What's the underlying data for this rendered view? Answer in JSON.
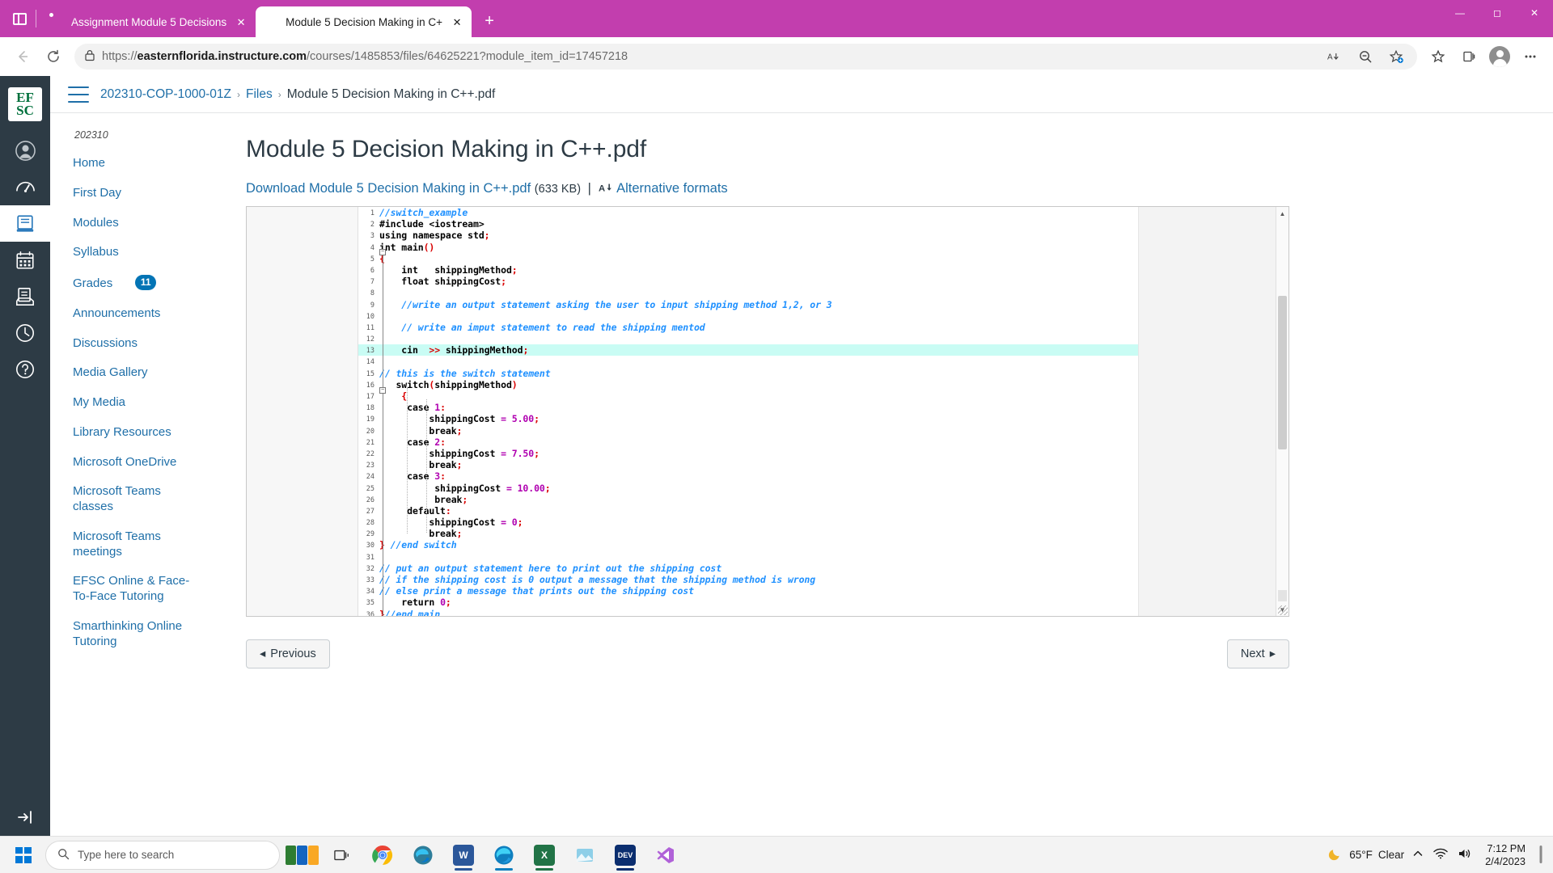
{
  "browser": {
    "tabs": [
      {
        "title": "Assignment Module 5 Decisions",
        "favicon": "canvas-icon",
        "active": false
      },
      {
        "title": "Module 5 Decision Making in C+",
        "favicon": "canvas-icon",
        "active": true
      }
    ],
    "new_tab_label": "+",
    "window_controls": {
      "minimize": "—",
      "maximize": "☐",
      "close": "✕"
    },
    "toolbar": {
      "back_icon": "back-arrow-icon",
      "refresh_icon": "refresh-icon",
      "lock_icon": "lock-icon",
      "url_scheme": "https://",
      "url_host": "easternflorida.instructure.com",
      "url_path": "/courses/1485853/files/64625221?module_item_id=17457218",
      "read_aloud_icon": "read-aloud-icon",
      "zoom_out_icon": "zoom-out-icon",
      "favorites_add_icon": "add-favorite-icon",
      "favorites_icon": "favorites-icon",
      "collections_icon": "collections-icon",
      "profile_icon": "profile-icon",
      "settings_icon": "more-settings-icon"
    }
  },
  "globalnav": {
    "logo_line1": "EF",
    "logo_line2": "SC",
    "items": [
      {
        "name": "account",
        "label": "Account"
      },
      {
        "name": "dashboard",
        "label": "Dashboard"
      },
      {
        "name": "courses",
        "label": "Courses",
        "active": true
      },
      {
        "name": "calendar",
        "label": "Calendar"
      },
      {
        "name": "inbox",
        "label": "Inbox"
      },
      {
        "name": "history",
        "label": "History"
      },
      {
        "name": "help",
        "label": "Help"
      }
    ]
  },
  "coursenav": {
    "term": "202310",
    "items": [
      {
        "label": "Home",
        "badge": null
      },
      {
        "label": "First Day",
        "badge": null
      },
      {
        "label": "Modules",
        "badge": null
      },
      {
        "label": "Syllabus",
        "badge": null
      },
      {
        "label": "Grades",
        "badge": "11"
      },
      {
        "label": "Announcements",
        "badge": null
      },
      {
        "label": "Discussions",
        "badge": null
      },
      {
        "label": "Media Gallery",
        "badge": null
      },
      {
        "label": "My Media",
        "badge": null
      },
      {
        "label": "Library Resources",
        "badge": null
      },
      {
        "label": "Microsoft OneDrive",
        "badge": null
      },
      {
        "label": "Microsoft Teams classes",
        "badge": null
      },
      {
        "label": "Microsoft Teams meetings",
        "badge": null
      },
      {
        "label": "EFSC Online & Face-To-Face Tutoring",
        "badge": null
      },
      {
        "label": "Smarthinking Online Tutoring",
        "badge": null
      }
    ]
  },
  "breadcrumb": {
    "course": "202310-COP-1000-01Z",
    "section": "Files",
    "current": "Module 5 Decision Making in C++.pdf"
  },
  "main": {
    "file_title": "Module 5 Decision Making in C++.pdf",
    "download_label": "Download Module 5 Decision Making in C++.pdf",
    "file_size": "(633 KB)",
    "separator": "|",
    "alt_formats_label": "Alternative formats",
    "alt_formats_icon": "accessibility-download-icon"
  },
  "pager": {
    "previous_label": "Previous",
    "previous_arrow": "◂",
    "next_label": "Next",
    "next_arrow": "▸"
  },
  "pdf": {
    "lines": [
      {
        "n": "1",
        "tokens": [
          {
            "t": "//switch_example",
            "c": "cm"
          }
        ],
        "indent": 0
      },
      {
        "n": "2",
        "tokens": [
          {
            "t": "#include <iostream>",
            "c": "pp"
          }
        ],
        "indent": 0
      },
      {
        "n": "3",
        "tokens": [
          {
            "t": "using namespace std",
            "c": "kw"
          },
          {
            "t": ";",
            "c": "pn"
          }
        ],
        "indent": 0
      },
      {
        "n": "4",
        "tokens": [
          {
            "t": "int main",
            "c": "kw"
          },
          {
            "t": "()",
            "c": "pn"
          }
        ],
        "indent": 0
      },
      {
        "n": "5",
        "tokens": [
          {
            "t": "{",
            "c": "pn"
          }
        ],
        "indent": 0
      },
      {
        "n": "6",
        "tokens": [
          {
            "t": "    int   shippingMethod",
            "c": "kw"
          },
          {
            "t": ";",
            "c": "pn"
          }
        ],
        "indent": 0
      },
      {
        "n": "7",
        "tokens": [
          {
            "t": "    float shippingCost",
            "c": "kw"
          },
          {
            "t": ";",
            "c": "pn"
          }
        ],
        "indent": 0
      },
      {
        "n": "8",
        "tokens": [],
        "indent": 0
      },
      {
        "n": "9",
        "tokens": [
          {
            "t": "    //write an output statement asking the user to input shipping method 1,2, or 3",
            "c": "cm"
          }
        ],
        "indent": 0
      },
      {
        "n": "10",
        "tokens": [],
        "indent": 0
      },
      {
        "n": "11",
        "tokens": [
          {
            "t": "    // write an imput statement to read the shipping mentod",
            "c": "cm"
          }
        ],
        "indent": 0
      },
      {
        "n": "12",
        "tokens": [],
        "indent": 0
      },
      {
        "n": "13",
        "tokens": [
          {
            "t": "    cin  ",
            "c": "kw"
          },
          {
            "t": ">>",
            "c": "op"
          },
          {
            "t": " shippingMethod",
            "c": "kw"
          },
          {
            "t": ";",
            "c": "pn"
          }
        ],
        "indent": 0,
        "highlight": true
      },
      {
        "n": "14",
        "tokens": [],
        "indent": 0
      },
      {
        "n": "15",
        "tokens": [
          {
            "t": "// this is the switch statement",
            "c": "cm"
          }
        ],
        "indent": 0
      },
      {
        "n": "16",
        "tokens": [
          {
            "t": "   switch",
            "c": "kw"
          },
          {
            "t": "(",
            "c": "pn"
          },
          {
            "t": "shippingMethod",
            "c": "kw"
          },
          {
            "t": ")",
            "c": "pn"
          }
        ],
        "indent": 0
      },
      {
        "n": "17",
        "tokens": [
          {
            "t": "    ",
            "c": "kw"
          },
          {
            "t": "{",
            "c": "pn"
          }
        ],
        "indent": 0
      },
      {
        "n": "18",
        "tokens": [
          {
            "t": "     case ",
            "c": "kw"
          },
          {
            "t": "1",
            "c": "num"
          },
          {
            "t": ":",
            "c": "pn"
          }
        ],
        "indent": 0
      },
      {
        "n": "19",
        "tokens": [
          {
            "t": "         shippingCost ",
            "c": "kw"
          },
          {
            "t": "=",
            "c": "num"
          },
          {
            "t": " ",
            "c": "kw"
          },
          {
            "t": "5.00",
            "c": "num"
          },
          {
            "t": ";",
            "c": "pn"
          }
        ],
        "indent": 0
      },
      {
        "n": "20",
        "tokens": [
          {
            "t": "         break",
            "c": "kw"
          },
          {
            "t": ";",
            "c": "pn"
          }
        ],
        "indent": 0
      },
      {
        "n": "21",
        "tokens": [
          {
            "t": "     case ",
            "c": "kw"
          },
          {
            "t": "2",
            "c": "num"
          },
          {
            "t": ":",
            "c": "pn"
          }
        ],
        "indent": 0
      },
      {
        "n": "22",
        "tokens": [
          {
            "t": "         shippingCost ",
            "c": "kw"
          },
          {
            "t": "=",
            "c": "num"
          },
          {
            "t": " ",
            "c": "kw"
          },
          {
            "t": "7.50",
            "c": "num"
          },
          {
            "t": ";",
            "c": "pn"
          }
        ],
        "indent": 0
      },
      {
        "n": "23",
        "tokens": [
          {
            "t": "         break",
            "c": "kw"
          },
          {
            "t": ";",
            "c": "pn"
          }
        ],
        "indent": 0
      },
      {
        "n": "24",
        "tokens": [
          {
            "t": "     case ",
            "c": "kw"
          },
          {
            "t": "3",
            "c": "num"
          },
          {
            "t": ":",
            "c": "pn"
          }
        ],
        "indent": 0
      },
      {
        "n": "25",
        "tokens": [
          {
            "t": "          shippingCost ",
            "c": "kw"
          },
          {
            "t": "=",
            "c": "num"
          },
          {
            "t": " ",
            "c": "kw"
          },
          {
            "t": "10.00",
            "c": "num"
          },
          {
            "t": ";",
            "c": "pn"
          }
        ],
        "indent": 0
      },
      {
        "n": "26",
        "tokens": [
          {
            "t": "          break",
            "c": "kw"
          },
          {
            "t": ";",
            "c": "pn"
          }
        ],
        "indent": 0
      },
      {
        "n": "27",
        "tokens": [
          {
            "t": "     default",
            "c": "kw"
          },
          {
            "t": ":",
            "c": "pn"
          }
        ],
        "indent": 0
      },
      {
        "n": "28",
        "tokens": [
          {
            "t": "         shippingCost ",
            "c": "kw"
          },
          {
            "t": "=",
            "c": "num"
          },
          {
            "t": " ",
            "c": "kw"
          },
          {
            "t": "0",
            "c": "num"
          },
          {
            "t": ";",
            "c": "pn"
          }
        ],
        "indent": 0
      },
      {
        "n": "29",
        "tokens": [
          {
            "t": "         break",
            "c": "kw"
          },
          {
            "t": ";",
            "c": "pn"
          }
        ],
        "indent": 0
      },
      {
        "n": "30",
        "tokens": [
          {
            "t": "}",
            "c": "pn"
          },
          {
            "t": " //end switch",
            "c": "cm"
          }
        ],
        "indent": 0
      },
      {
        "n": "31",
        "tokens": [],
        "indent": 0
      },
      {
        "n": "32",
        "tokens": [
          {
            "t": "// put an output statement here to print out the shipping cost",
            "c": "cm"
          }
        ],
        "indent": 0
      },
      {
        "n": "33",
        "tokens": [
          {
            "t": "// if the shipping cost is 0 output a message that the shipping method is wrong",
            "c": "cm"
          }
        ],
        "indent": 0
      },
      {
        "n": "34",
        "tokens": [
          {
            "t": "// else print a message that prints out the shipping cost",
            "c": "cm"
          }
        ],
        "indent": 0
      },
      {
        "n": "35",
        "tokens": [
          {
            "t": "    return ",
            "c": "kw"
          },
          {
            "t": "0",
            "c": "num"
          },
          {
            "t": ";",
            "c": "pn"
          }
        ],
        "indent": 0
      },
      {
        "n": "36",
        "tokens": [
          {
            "t": "}",
            "c": "pn"
          },
          {
            "t": "//end main",
            "c": "cm"
          }
        ],
        "indent": 0
      }
    ]
  },
  "taskbar": {
    "start_icon": "windows-start-icon",
    "search_placeholder": "Type here to search",
    "search_icon": "search-icon",
    "task_view_icon": "task-view-icon",
    "apps": [
      {
        "name": "widgets-news",
        "label": ""
      },
      {
        "name": "task-view",
        "label": ""
      },
      {
        "name": "google-chrome",
        "label": ""
      },
      {
        "name": "edge-dev",
        "label": ""
      },
      {
        "name": "microsoft-word",
        "label": "W"
      },
      {
        "name": "microsoft-edge",
        "label": ""
      },
      {
        "name": "microsoft-excel",
        "label": "X"
      },
      {
        "name": "photos",
        "label": ""
      },
      {
        "name": "dev-cpp",
        "label": "DEV"
      },
      {
        "name": "visual-studio",
        "label": ""
      }
    ],
    "weather_icon": "moon-icon",
    "temperature": "65°F",
    "condition": "Clear",
    "overflow_icon": "show-hidden-icons-icon",
    "network_icon": "wifi-icon",
    "volume_icon": "volume-icon",
    "time": "7:12 PM",
    "date": "2/4/2023",
    "notifications_icon": "notifications-icon"
  }
}
